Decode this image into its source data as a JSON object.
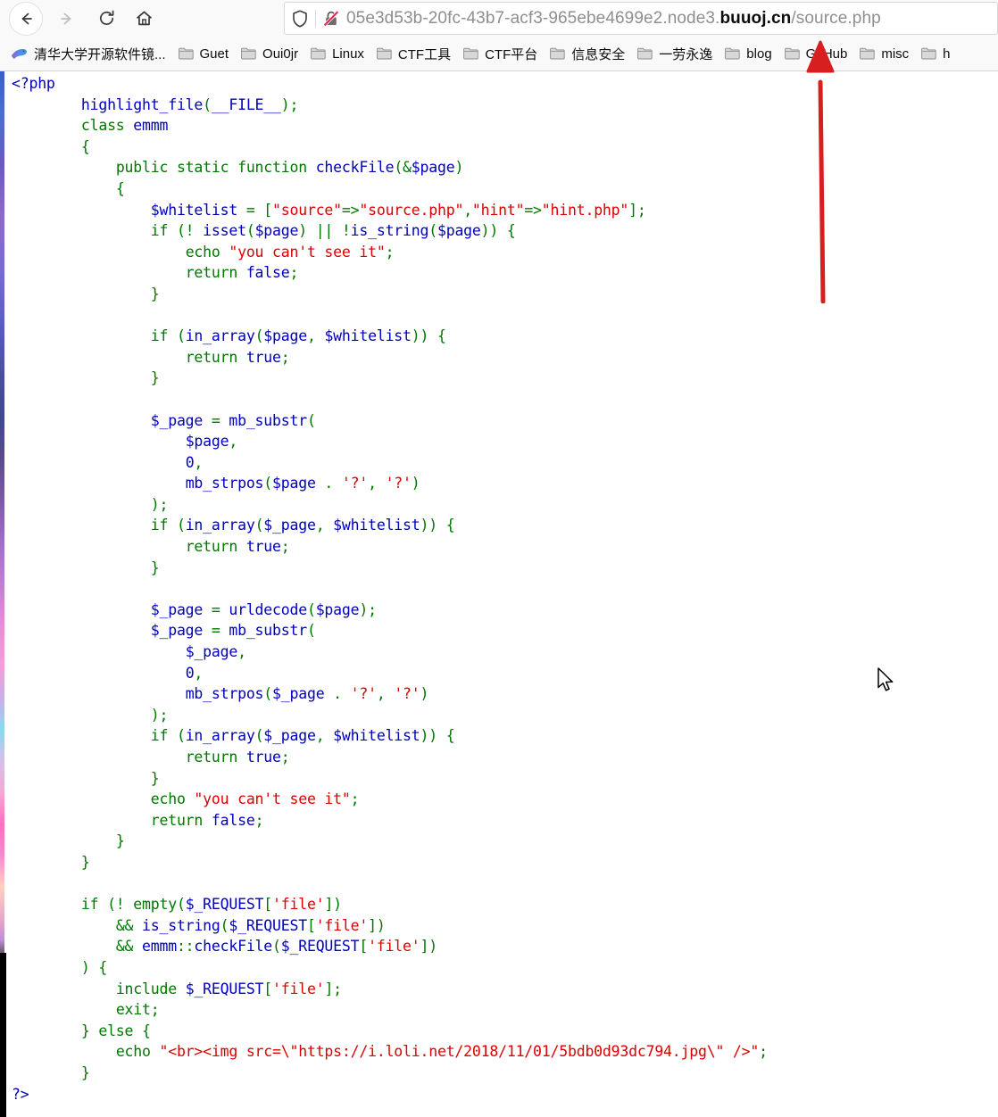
{
  "browser": {
    "nav": {
      "back_label": "Back",
      "forward_label": "Forward",
      "reload_label": "Reload",
      "home_label": "Home"
    },
    "urlbar": {
      "shield_icon": "shield-icon",
      "lock_icon": "lock-crossed-icon",
      "url_prefix": "05e3d53b-20fc-43b7-acf3-965ebe4699e2.node3.",
      "url_host": "buuoj.cn",
      "url_suffix": "/source.php",
      "full_url": "05e3d53b-20fc-43b7-acf3-965ebe4699e2.node3.buuoj.cn/source.php"
    },
    "bookmarks": [
      {
        "label": "清华大学开源软件镜...",
        "icon": "bird-icon"
      },
      {
        "label": "Guet",
        "icon": "folder-icon"
      },
      {
        "label": "Oui0jr",
        "icon": "folder-icon"
      },
      {
        "label": "Linux",
        "icon": "folder-icon"
      },
      {
        "label": "CTF工具",
        "icon": "folder-icon"
      },
      {
        "label": "CTF平台",
        "icon": "folder-icon"
      },
      {
        "label": "信息安全",
        "icon": "folder-icon"
      },
      {
        "label": "一劳永逸",
        "icon": "folder-icon"
      },
      {
        "label": "blog",
        "icon": "folder-icon"
      },
      {
        "label": "GitHub",
        "icon": "folder-icon"
      },
      {
        "label": "misc",
        "icon": "folder-icon"
      },
      {
        "label": "h",
        "icon": "folder-icon"
      }
    ]
  },
  "annotation": {
    "arrow_color": "#d81f1f",
    "arrow_direction": "up",
    "points_to": "bookmark-blog"
  },
  "colors": {
    "php_tag": "#0000BB",
    "keyword": "#007700",
    "string": "#DD0000",
    "variable": "#0000BB",
    "function": "#0000BB",
    "page_background": "#FFFFFF",
    "chrome_background": "#F9F9FA",
    "url_host": "#0C0C0D",
    "url_path": "#8E8E93"
  },
  "page": {
    "code_lines": [
      [
        [
          "<?php",
          "tag"
        ]
      ],
      [
        [
          "        ",
          "plain"
        ],
        [
          "highlight_file",
          "fn"
        ],
        [
          "(",
          "kw"
        ],
        [
          "__FILE__",
          "default"
        ],
        [
          "); ",
          "kw"
        ]
      ],
      [
        [
          "        ",
          "plain"
        ],
        [
          "class ",
          "kw"
        ],
        [
          "emmm",
          "default"
        ]
      ],
      [
        [
          "        ",
          "plain"
        ],
        [
          "{",
          "kw"
        ]
      ],
      [
        [
          "            ",
          "plain"
        ],
        [
          "public ",
          "kw"
        ],
        [
          "static ",
          "kw"
        ],
        [
          "function ",
          "kw"
        ],
        [
          "checkFile",
          "default"
        ],
        [
          "(&",
          "kw"
        ],
        [
          "$page",
          "default"
        ],
        [
          ")",
          "kw"
        ]
      ],
      [
        [
          "            ",
          "plain"
        ],
        [
          "{",
          "kw"
        ]
      ],
      [
        [
          "                ",
          "plain"
        ],
        [
          "$whitelist",
          "default"
        ],
        [
          " = [",
          "kw"
        ],
        [
          "\"source\"",
          "str"
        ],
        [
          "=>",
          "kw"
        ],
        [
          "\"source.php\"",
          "str"
        ],
        [
          ",",
          "kw"
        ],
        [
          "\"hint\"",
          "str"
        ],
        [
          "=>",
          "kw"
        ],
        [
          "\"hint.php\"",
          "str"
        ],
        [
          "];",
          "kw"
        ]
      ],
      [
        [
          "                ",
          "plain"
        ],
        [
          "if ",
          "kw"
        ],
        [
          "(! ",
          "kw"
        ],
        [
          "isset",
          "default"
        ],
        [
          "(",
          "kw"
        ],
        [
          "$page",
          "default"
        ],
        [
          ") || !",
          "kw"
        ],
        [
          "is_string",
          "default"
        ],
        [
          "(",
          "kw"
        ],
        [
          "$page",
          "default"
        ],
        [
          ")) {",
          "kw"
        ]
      ],
      [
        [
          "                    ",
          "plain"
        ],
        [
          "echo ",
          "kw"
        ],
        [
          "\"you can't see it\"",
          "str"
        ],
        [
          ";",
          "kw"
        ]
      ],
      [
        [
          "                    ",
          "plain"
        ],
        [
          "return ",
          "kw"
        ],
        [
          "false",
          "default"
        ],
        [
          ";",
          "kw"
        ]
      ],
      [
        [
          "                ",
          "plain"
        ],
        [
          "}",
          "kw"
        ]
      ],
      [
        [
          "",
          "plain"
        ]
      ],
      [
        [
          "                ",
          "plain"
        ],
        [
          "if ",
          "kw"
        ],
        [
          "(",
          "kw"
        ],
        [
          "in_array",
          "default"
        ],
        [
          "(",
          "kw"
        ],
        [
          "$page",
          "default"
        ],
        [
          ", ",
          "kw"
        ],
        [
          "$whitelist",
          "default"
        ],
        [
          ")) {",
          "kw"
        ]
      ],
      [
        [
          "                    ",
          "plain"
        ],
        [
          "return ",
          "kw"
        ],
        [
          "true",
          "default"
        ],
        [
          ";",
          "kw"
        ]
      ],
      [
        [
          "                ",
          "plain"
        ],
        [
          "}",
          "kw"
        ]
      ],
      [
        [
          "",
          "plain"
        ]
      ],
      [
        [
          "                ",
          "plain"
        ],
        [
          "$_page",
          "default"
        ],
        [
          " = ",
          "kw"
        ],
        [
          "mb_substr",
          "default"
        ],
        [
          "(",
          "kw"
        ]
      ],
      [
        [
          "                    ",
          "plain"
        ],
        [
          "$page",
          "default"
        ],
        [
          ",",
          "kw"
        ]
      ],
      [
        [
          "                    ",
          "plain"
        ],
        [
          "0",
          "default"
        ],
        [
          ",",
          "kw"
        ]
      ],
      [
        [
          "                    ",
          "plain"
        ],
        [
          "mb_strpos",
          "default"
        ],
        [
          "(",
          "kw"
        ],
        [
          "$page",
          "default"
        ],
        [
          " . ",
          "kw"
        ],
        [
          "'?'",
          "str"
        ],
        [
          ", ",
          "kw"
        ],
        [
          "'?'",
          "str"
        ],
        [
          ")",
          "kw"
        ]
      ],
      [
        [
          "                ",
          "plain"
        ],
        [
          ");",
          "kw"
        ]
      ],
      [
        [
          "                ",
          "plain"
        ],
        [
          "if ",
          "kw"
        ],
        [
          "(",
          "kw"
        ],
        [
          "in_array",
          "default"
        ],
        [
          "(",
          "kw"
        ],
        [
          "$_page",
          "default"
        ],
        [
          ", ",
          "kw"
        ],
        [
          "$whitelist",
          "default"
        ],
        [
          ")) {",
          "kw"
        ]
      ],
      [
        [
          "                    ",
          "plain"
        ],
        [
          "return ",
          "kw"
        ],
        [
          "true",
          "default"
        ],
        [
          ";",
          "kw"
        ]
      ],
      [
        [
          "                ",
          "plain"
        ],
        [
          "}",
          "kw"
        ]
      ],
      [
        [
          "",
          "plain"
        ]
      ],
      [
        [
          "                ",
          "plain"
        ],
        [
          "$_page",
          "default"
        ],
        [
          " = ",
          "kw"
        ],
        [
          "urldecode",
          "default"
        ],
        [
          "(",
          "kw"
        ],
        [
          "$page",
          "default"
        ],
        [
          ");",
          "kw"
        ]
      ],
      [
        [
          "                ",
          "plain"
        ],
        [
          "$_page",
          "default"
        ],
        [
          " = ",
          "kw"
        ],
        [
          "mb_substr",
          "default"
        ],
        [
          "(",
          "kw"
        ]
      ],
      [
        [
          "                    ",
          "plain"
        ],
        [
          "$_page",
          "default"
        ],
        [
          ",",
          "kw"
        ]
      ],
      [
        [
          "                    ",
          "plain"
        ],
        [
          "0",
          "default"
        ],
        [
          ",",
          "kw"
        ]
      ],
      [
        [
          "                    ",
          "plain"
        ],
        [
          "mb_strpos",
          "default"
        ],
        [
          "(",
          "kw"
        ],
        [
          "$_page",
          "default"
        ],
        [
          " . ",
          "kw"
        ],
        [
          "'?'",
          "str"
        ],
        [
          ", ",
          "kw"
        ],
        [
          "'?'",
          "str"
        ],
        [
          ")",
          "kw"
        ]
      ],
      [
        [
          "                ",
          "plain"
        ],
        [
          ");",
          "kw"
        ]
      ],
      [
        [
          "                ",
          "plain"
        ],
        [
          "if ",
          "kw"
        ],
        [
          "(",
          "kw"
        ],
        [
          "in_array",
          "default"
        ],
        [
          "(",
          "kw"
        ],
        [
          "$_page",
          "default"
        ],
        [
          ", ",
          "kw"
        ],
        [
          "$whitelist",
          "default"
        ],
        [
          ")) {",
          "kw"
        ]
      ],
      [
        [
          "                    ",
          "plain"
        ],
        [
          "return ",
          "kw"
        ],
        [
          "true",
          "default"
        ],
        [
          ";",
          "kw"
        ]
      ],
      [
        [
          "                ",
          "plain"
        ],
        [
          "}",
          "kw"
        ]
      ],
      [
        [
          "                ",
          "plain"
        ],
        [
          "echo ",
          "kw"
        ],
        [
          "\"you can't see it\"",
          "str"
        ],
        [
          ";",
          "kw"
        ]
      ],
      [
        [
          "                ",
          "plain"
        ],
        [
          "return ",
          "kw"
        ],
        [
          "false",
          "default"
        ],
        [
          ";",
          "kw"
        ]
      ],
      [
        [
          "            ",
          "plain"
        ],
        [
          "}",
          "kw"
        ]
      ],
      [
        [
          "        ",
          "plain"
        ],
        [
          "}",
          "kw"
        ]
      ],
      [
        [
          "",
          "plain"
        ]
      ],
      [
        [
          "        ",
          "plain"
        ],
        [
          "if ",
          "kw"
        ],
        [
          "(! ",
          "kw"
        ],
        [
          "empty",
          "kw"
        ],
        [
          "(",
          "kw"
        ],
        [
          "$_REQUEST",
          "default"
        ],
        [
          "[",
          "kw"
        ],
        [
          "'file'",
          "str"
        ],
        [
          "])",
          "kw"
        ]
      ],
      [
        [
          "            ",
          "plain"
        ],
        [
          "&& ",
          "kw"
        ],
        [
          "is_string",
          "default"
        ],
        [
          "(",
          "kw"
        ],
        [
          "$_REQUEST",
          "default"
        ],
        [
          "[",
          "kw"
        ],
        [
          "'file'",
          "str"
        ],
        [
          "])",
          "kw"
        ]
      ],
      [
        [
          "            ",
          "plain"
        ],
        [
          "&& ",
          "kw"
        ],
        [
          "emmm",
          "default"
        ],
        [
          "::",
          "kw"
        ],
        [
          "checkFile",
          "default"
        ],
        [
          "(",
          "kw"
        ],
        [
          "$_REQUEST",
          "default"
        ],
        [
          "[",
          "kw"
        ],
        [
          "'file'",
          "str"
        ],
        [
          "])",
          "kw"
        ]
      ],
      [
        [
          "        ",
          "plain"
        ],
        [
          ") {",
          "kw"
        ]
      ],
      [
        [
          "            ",
          "plain"
        ],
        [
          "include ",
          "kw"
        ],
        [
          "$_REQUEST",
          "default"
        ],
        [
          "[",
          "kw"
        ],
        [
          "'file'",
          "str"
        ],
        [
          "];",
          "kw"
        ]
      ],
      [
        [
          "            ",
          "plain"
        ],
        [
          "exit",
          "kw"
        ],
        [
          ";",
          "kw"
        ]
      ],
      [
        [
          "        ",
          "plain"
        ],
        [
          "} ",
          "kw"
        ],
        [
          "else ",
          "kw"
        ],
        [
          "{",
          "kw"
        ]
      ],
      [
        [
          "            ",
          "plain"
        ],
        [
          "echo ",
          "kw"
        ],
        [
          "\"<br><img src=\\\"https://i.loli.net/2018/11/01/5bdb0d93dc794.jpg\\\" />\"",
          "str"
        ],
        [
          ";",
          "kw"
        ]
      ],
      [
        [
          "        ",
          "plain"
        ],
        [
          "}",
          "kw"
        ]
      ],
      [
        [
          "?>",
          "tag"
        ]
      ]
    ]
  }
}
